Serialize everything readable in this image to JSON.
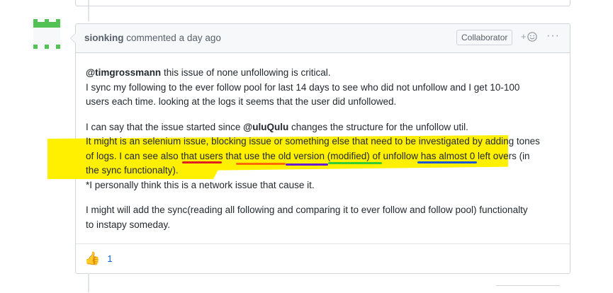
{
  "comment": {
    "author": "sionking",
    "action": "commented",
    "time": "a day ago",
    "badge": "Collaborator",
    "reaction_add_label": "+",
    "more_label": "···",
    "body": {
      "p1_mention": "@timgrossmann",
      "p1_l1": " this issue of none unfollowing is critical.",
      "p1_l2": "I sync my following to the ever follow pool for last 14 days to see who did not unfollow and I get 10-100",
      "p1_l3": "users each time. looking at the logs it seems that the user did unfollowed.",
      "p2_l1_pre": "I can say that the issue started since ",
      "p2_mention": "@uluQulu",
      "p2_l1_post": " changes the structure for the unfollow util.",
      "p2_l2": "It might is an selenium issue, blocking issue or something else that need to be investigated by adding tones",
      "p2_l3": "of logs. I can see also that users that use the old version (modified) of unfollow has almost 0 left overs (in",
      "p2_l4": "the sync functionalty).",
      "p2_l5": "*I personally think this is a network issue that cause it.",
      "p3_l1": "I might will add the sync(reading all following and comparing it to ever follow and follow pool) functionalty",
      "p3_l2": "to instapy someday."
    },
    "reactions": [
      {
        "emoji": "👍",
        "icon": "thumbs-up-icon",
        "count": "1"
      }
    ]
  },
  "colors": {
    "highlight": "#fff000",
    "underline_red": "#e02020",
    "underline_orange": "#ff6a00",
    "underline_purple": "#6a1bd1",
    "underline_green": "#33cc33",
    "underline_blue": "#1a56d6",
    "avatar_green": "#52c255"
  }
}
